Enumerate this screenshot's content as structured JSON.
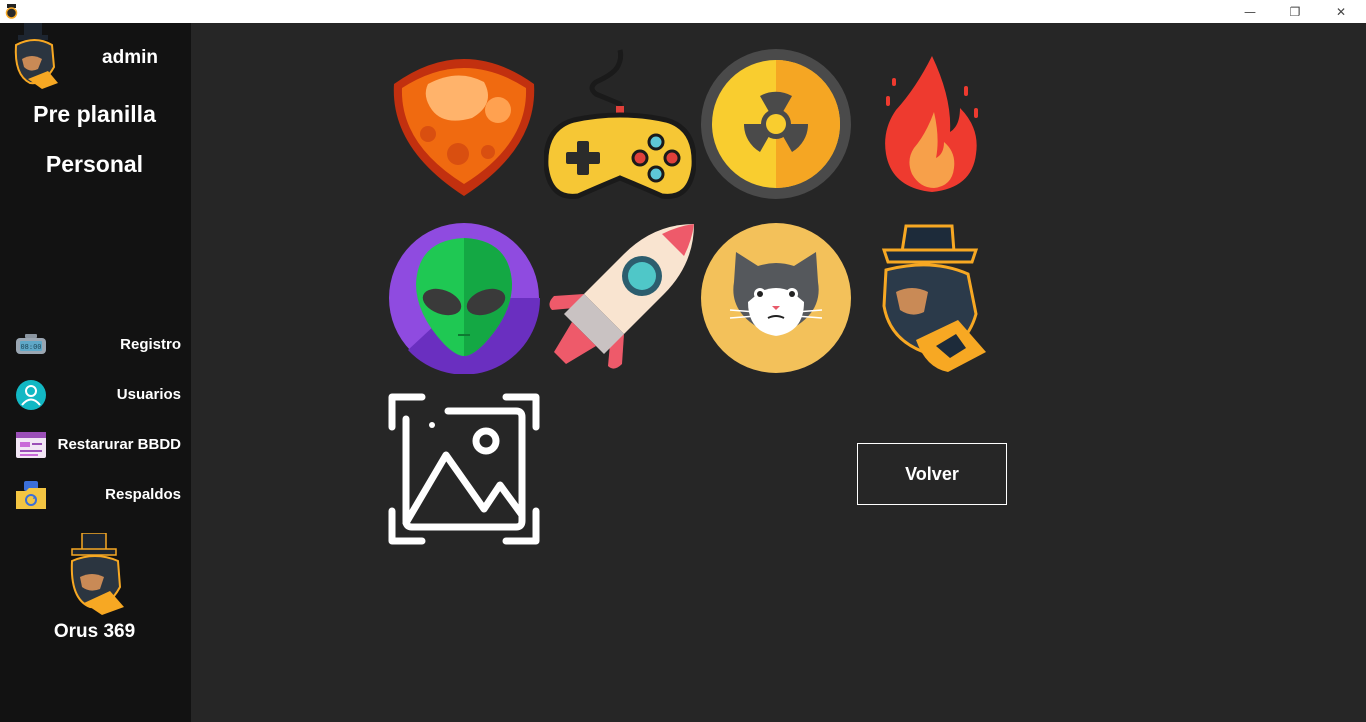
{
  "window": {
    "minimize_glyph": "—",
    "maximize_glyph": "❐",
    "close_glyph": "✕"
  },
  "sidebar": {
    "user_name": "admin",
    "menu": [
      {
        "label": "Pre planilla"
      },
      {
        "label": "Personal"
      }
    ],
    "nav": [
      {
        "label": "Registro",
        "icon": "clock-icon"
      },
      {
        "label": "Usuarios",
        "icon": "user-icon"
      },
      {
        "label": "Restarurar BBDD",
        "icon": "database-restore-icon"
      },
      {
        "label": "Respaldos",
        "icon": "backup-icon"
      }
    ],
    "brand": "Orus 369"
  },
  "avatars": [
    {
      "name": "meteor-avatar-icon"
    },
    {
      "name": "gamepad-avatar-icon"
    },
    {
      "name": "radiation-avatar-icon"
    },
    {
      "name": "fire-avatar-icon"
    },
    {
      "name": "alien-avatar-icon"
    },
    {
      "name": "rocket-avatar-icon"
    },
    {
      "name": "cat-avatar-icon"
    },
    {
      "name": "gentleman-monkey-avatar-icon"
    },
    {
      "name": "upload-image-icon"
    }
  ],
  "actions": {
    "back_label": "Volver"
  },
  "colors": {
    "sidebar_bg": "#121212",
    "content_bg": "#262626",
    "accent_orange": "#f7a823"
  }
}
